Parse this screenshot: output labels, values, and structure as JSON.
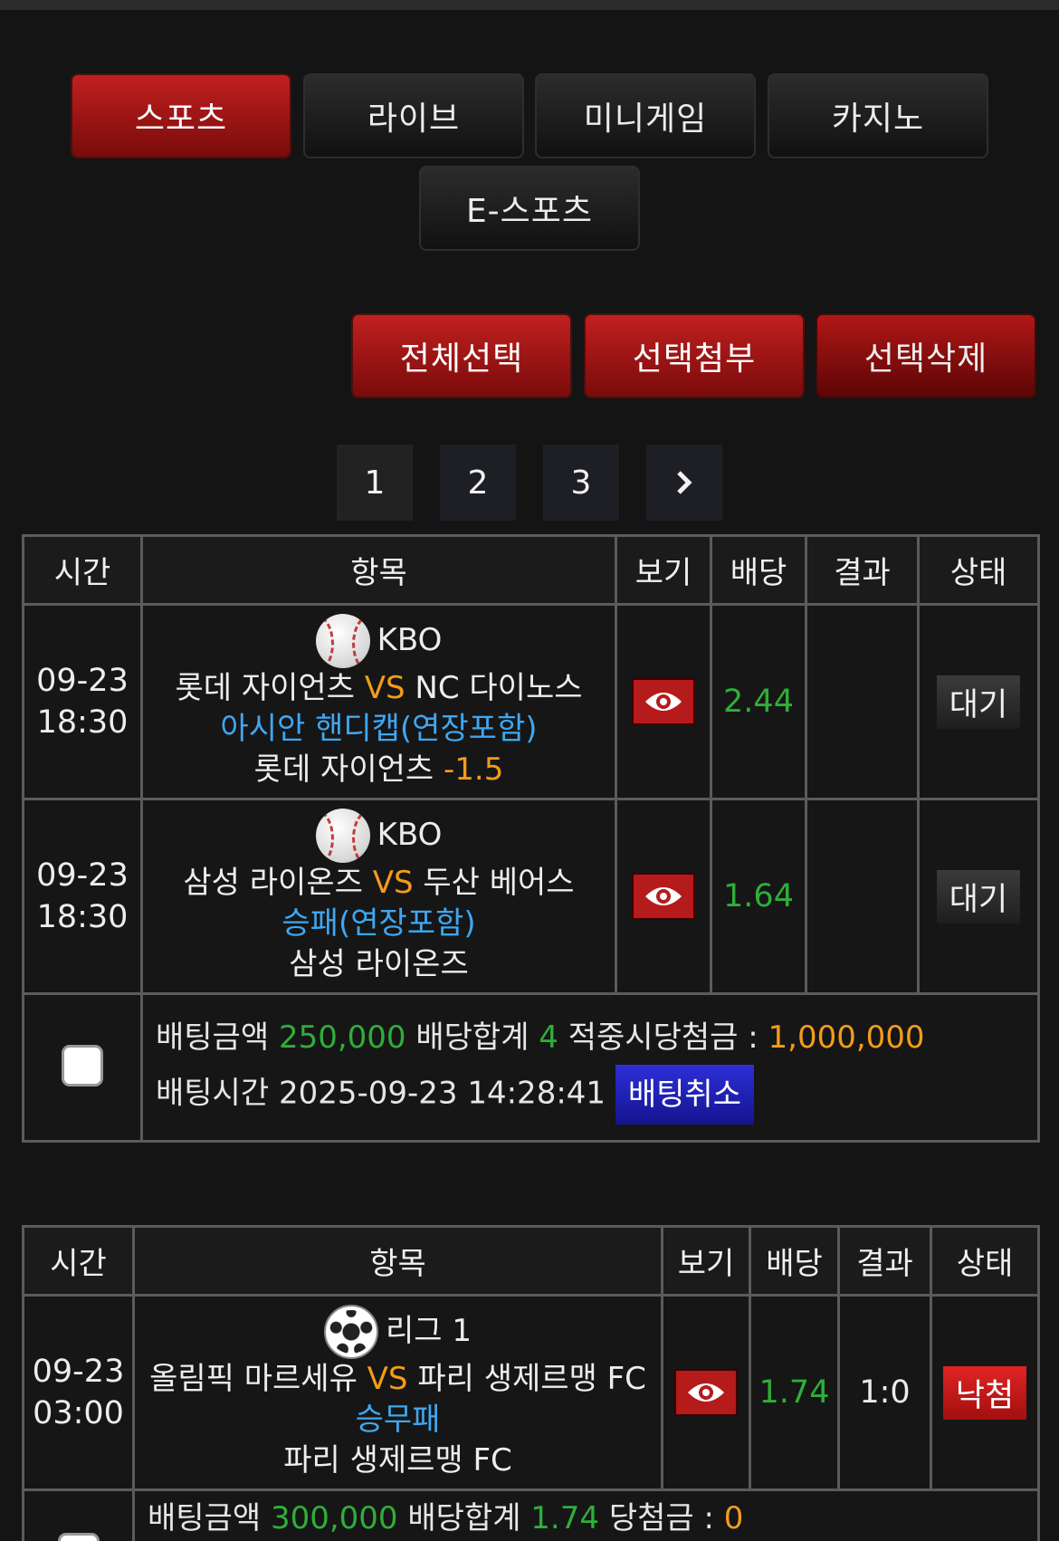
{
  "tabs": [
    "스포츠",
    "라이브",
    "미니게임",
    "카지노",
    "E-스포츠"
  ],
  "actions": [
    "전체선택",
    "선택첨부",
    "선택삭제"
  ],
  "pagination": {
    "pages": [
      "1",
      "2",
      "3"
    ],
    "next": "›"
  },
  "table_headers": [
    "시간",
    "항목",
    "보기",
    "배당",
    "결과",
    "상태"
  ],
  "bet1": {
    "games": [
      {
        "date": "09-23",
        "time": "18:30",
        "league": "KBO",
        "sport_icon": "baseball-icon",
        "home": "롯데 자이언츠",
        "vs": "VS",
        "away": "NC 다이노스",
        "market": "아시안 핸디캡(연장포함)",
        "pick": "롯데 자이언츠",
        "line": "-1.5",
        "odds": "2.44",
        "result": "",
        "status": "대기"
      },
      {
        "date": "09-23",
        "time": "18:30",
        "league": "KBO",
        "sport_icon": "baseball-icon",
        "home": "삼성 라이온즈",
        "vs": "VS",
        "away": "두산 베어스",
        "market": "승패(연장포함)",
        "pick": "삼성 라이온즈",
        "line": "",
        "odds": "1.64",
        "result": "",
        "status": "대기"
      }
    ],
    "amount_label": "배팅금액",
    "amount": "250,000",
    "odds_total_label": "배당합계",
    "odds_total": "4",
    "payout_label": "적중시당첨금 :",
    "payout": "1,000,000",
    "time_label": "배팅시간",
    "bet_time": "2025-09-23 14:28:41",
    "cancel": "배팅취소"
  },
  "bet2": {
    "games": [
      {
        "date": "09-23",
        "time": "03:00",
        "league": "리그 1",
        "sport_icon": "soccer-icon",
        "home": "올림픽 마르세유",
        "vs": "VS",
        "away": "파리 생제르맹 FC",
        "market": "승무패",
        "pick": "파리 생제르맹 FC",
        "line": "",
        "odds": "1.74",
        "result": "1:0",
        "status": "낙첨"
      }
    ],
    "amount_label": "배팅금액",
    "amount": "300,000",
    "odds_total_label": "배당합계",
    "odds_total": "1.74",
    "payout_label": "당첨금 :",
    "payout": "0"
  }
}
